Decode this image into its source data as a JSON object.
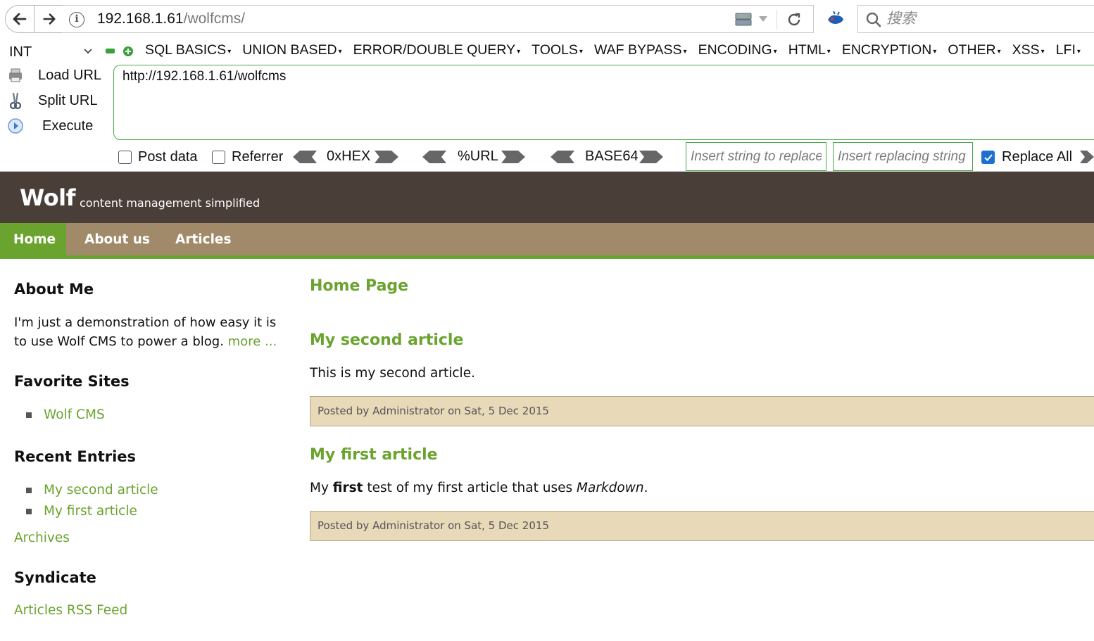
{
  "browser": {
    "url_host": "192.168.1.61",
    "url_path": "/wolfcms/",
    "search_placeholder": "搜索"
  },
  "hackbar": {
    "type_select": "INT",
    "menus": [
      "SQL BASICS",
      "UNION BASED",
      "ERROR/DOUBLE QUERY",
      "TOOLS",
      "WAF BYPASS",
      "ENCODING",
      "HTML",
      "ENCRYPTION",
      "OTHER",
      "XSS",
      "LFI"
    ],
    "actions": {
      "load": "Load URL",
      "split": "Split URL",
      "execute": "Execute"
    },
    "url_value": "http://192.168.1.61/wolfcms",
    "post_data_label": "Post data",
    "referrer_label": "Referrer",
    "hex_label": "0xHEX",
    "url_enc_label": "%URL",
    "base64_label": "BASE64",
    "find_placeholder": "Insert string to replace",
    "replace_placeholder": "Insert replacing string",
    "replace_all_label": "Replace All",
    "replace_all_checked": true,
    "accent_color": "#4aa84a"
  },
  "site": {
    "name": "Wolf",
    "slogan": "content management simplified",
    "nav": [
      "Home",
      "About us",
      "Articles"
    ],
    "colors": {
      "header": "#4a3e39",
      "nav": "#a08a69",
      "accent": "#6aa32e",
      "meta_bg": "#e8d9b9"
    }
  },
  "sidebar": {
    "about_title": "About Me",
    "about_text": "I'm just a demonstration of how easy it is to use Wolf CMS to power a blog.",
    "about_more": "more ...",
    "favorites_title": "Favorite Sites",
    "favorites": [
      "Wolf CMS"
    ],
    "recent_title": "Recent Entries",
    "recent": [
      "My second article",
      "My first article"
    ],
    "archives": "Archives",
    "syndicate_title": "Syndicate",
    "rss": "Articles RSS Feed"
  },
  "content": {
    "page_title": "Home Page",
    "articles": [
      {
        "title": "My second article",
        "body": "This is my second article.",
        "meta": "Posted by Administrator on Sat, 5 Dec 2015"
      },
      {
        "title": "My first article",
        "body_pre": "My ",
        "body_bold": "first",
        "body_mid": " test of my first article that uses ",
        "body_em": "Markdown",
        "body_post": ".",
        "meta": "Posted by Administrator on Sat, 5 Dec 2015"
      }
    ]
  }
}
